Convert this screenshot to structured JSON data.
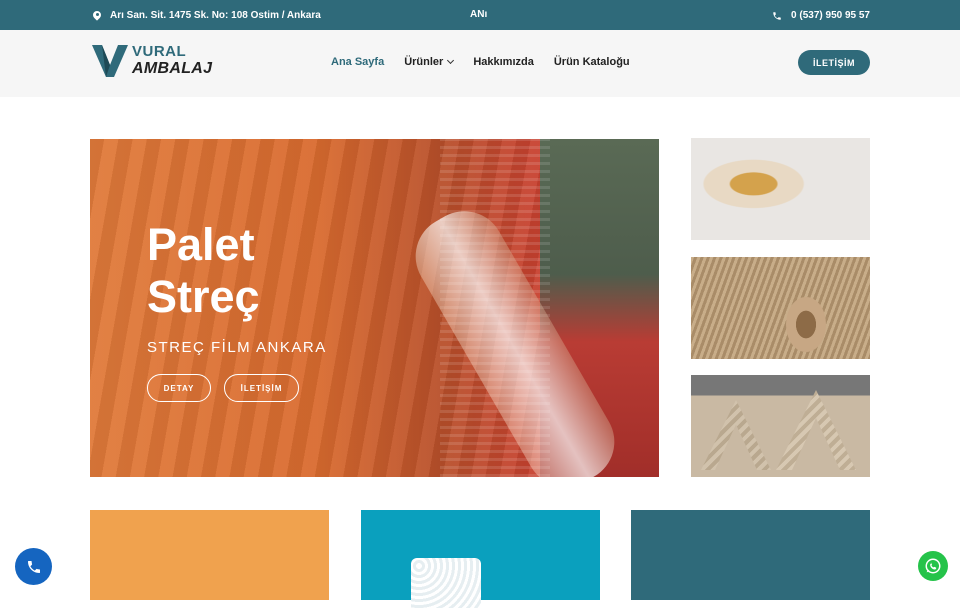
{
  "topbar": {
    "address": "Arı San. Sit. 1475 Sk. No: 108 Ostim / Ankara",
    "marquee": "ANı",
    "phone": "0 (537) 950 95 57",
    "address_icon": "map-pin-icon",
    "phone_icon": "phone-icon"
  },
  "brand": {
    "line1": "VURAL",
    "line2": "AMBALAJ",
    "primary_color": "#2f6a7a"
  },
  "nav": {
    "items": [
      {
        "label": "Ana Sayfa",
        "active": true
      },
      {
        "label": "Ürünler",
        "has_dropdown": true
      },
      {
        "label": "Hakkımızda"
      },
      {
        "label": "Ürün Kataloğu"
      }
    ],
    "cta": "İLETİŞİM"
  },
  "hero": {
    "title_line1": "Palet",
    "title_line2": "Streç",
    "subtitle": "STREÇ FİLM ANKARA",
    "btn_detail": "DETAY",
    "btn_contact": "İLETİŞİM"
  },
  "side_thumbs": [
    {
      "name": "packing-tape-image"
    },
    {
      "name": "corrugated-cardboard-image"
    },
    {
      "name": "corner-protector-image"
    }
  ],
  "cards": [
    {
      "color": "#f0a24e"
    },
    {
      "color": "#0aa0be"
    },
    {
      "color": "#2f6a7a"
    }
  ],
  "fabs": {
    "call_icon": "phone-icon",
    "whatsapp_icon": "whatsapp-icon"
  }
}
